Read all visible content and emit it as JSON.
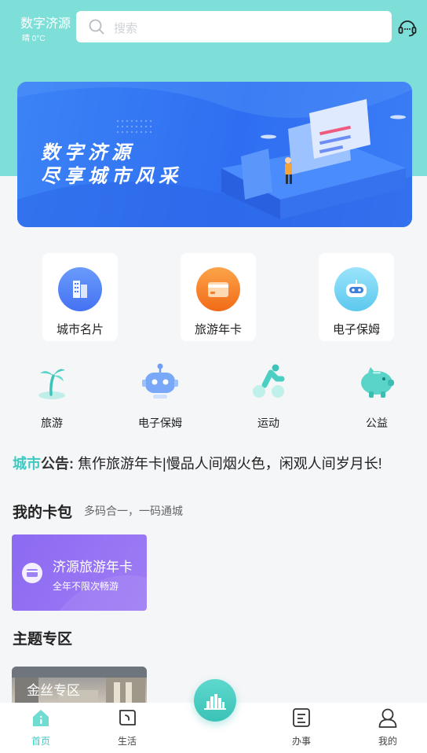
{
  "header": {
    "city": "数字济源",
    "weather": "晴 0°C",
    "search_placeholder": "搜索",
    "support_icon": "headset-icon"
  },
  "banner": {
    "line1": "数字济源",
    "line2": "尽享城市风采"
  },
  "quick_entries": [
    {
      "label": "城市名片",
      "icon": "building-icon",
      "color": "#4c7ef6"
    },
    {
      "label": "旅游年卡",
      "icon": "card-icon",
      "color": "#f7862a"
    },
    {
      "label": "电子保姆",
      "icon": "robot-icon",
      "color": "#6fd3f2"
    }
  ],
  "services": [
    {
      "label": "旅游",
      "icon": "palm-tree-icon"
    },
    {
      "label": "电子保姆",
      "icon": "robot-icon"
    },
    {
      "label": "运动",
      "icon": "cyclist-icon"
    },
    {
      "label": "公益",
      "icon": "piggy-bank-icon"
    }
  ],
  "notice": {
    "tag_part1": "城市",
    "tag_part2": "公告:",
    "text": "焦作旅游年卡|慢品人间烟火色，闲观人间岁月长!"
  },
  "wallet": {
    "title": "我的卡包",
    "subtitle": "多码合一，一码通城",
    "card_title": "济源旅游年卡",
    "card_subtitle": "全年不限次畅游"
  },
  "theme": {
    "title": "主题专区",
    "card_label": "金丝专区"
  },
  "tabbar": [
    {
      "label": "首页",
      "icon": "home-icon",
      "active": true
    },
    {
      "label": "生活",
      "icon": "life-icon",
      "active": false
    },
    {
      "label": "办事",
      "icon": "document-icon",
      "active": false
    },
    {
      "label": "我的",
      "icon": "user-icon",
      "active": false
    }
  ],
  "colors": {
    "accent": "#3fc9c0",
    "top_bg": "#7edfd8",
    "banner": "#3478f5"
  }
}
